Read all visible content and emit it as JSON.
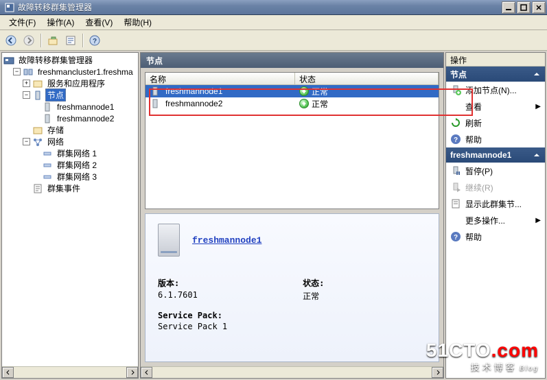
{
  "window": {
    "title": "故障转移群集管理器"
  },
  "menu": {
    "file": "文件(F)",
    "action": "操作(A)",
    "view": "查看(V)",
    "help": "帮助(H)"
  },
  "tree": {
    "root": "故障转移群集管理器",
    "cluster": "freshmancluster1.freshma",
    "services": "服务和应用程序",
    "nodes": "节点",
    "node1": "freshmannode1",
    "node2": "freshmannode2",
    "storage": "存储",
    "networks": "网络",
    "net1": "群集网络 1",
    "net2": "群集网络 2",
    "net3": "群集网络 3",
    "events": "群集事件"
  },
  "pane_title": "节点",
  "list": {
    "col_name": "名称",
    "col_status": "状态",
    "rows": [
      {
        "name": "freshmannode1",
        "status": "正常"
      },
      {
        "name": "freshmannode2",
        "status": "正常"
      }
    ]
  },
  "detail": {
    "link": "freshmannode1",
    "version_label": "版本:",
    "version_value": "6.1.7601",
    "status_label": "状态:",
    "status_value": "正常",
    "sp_label": "Service Pack:",
    "sp_value": "Service Pack 1"
  },
  "actions": {
    "header": "操作",
    "cat1": "节点",
    "add_node": "添加节点(N)...",
    "view": "查看",
    "refresh": "刷新",
    "help1": "帮助",
    "cat2": "freshmannode1",
    "pause": "暂停(P)",
    "resume": "继续(R)",
    "showev": "显示此群集节...",
    "more": "更多操作...",
    "help2": "帮助"
  },
  "watermark": {
    "brand_a": "51CTO",
    "brand_b": ".com",
    "sub": "技术博客",
    "blog": "Blog"
  }
}
